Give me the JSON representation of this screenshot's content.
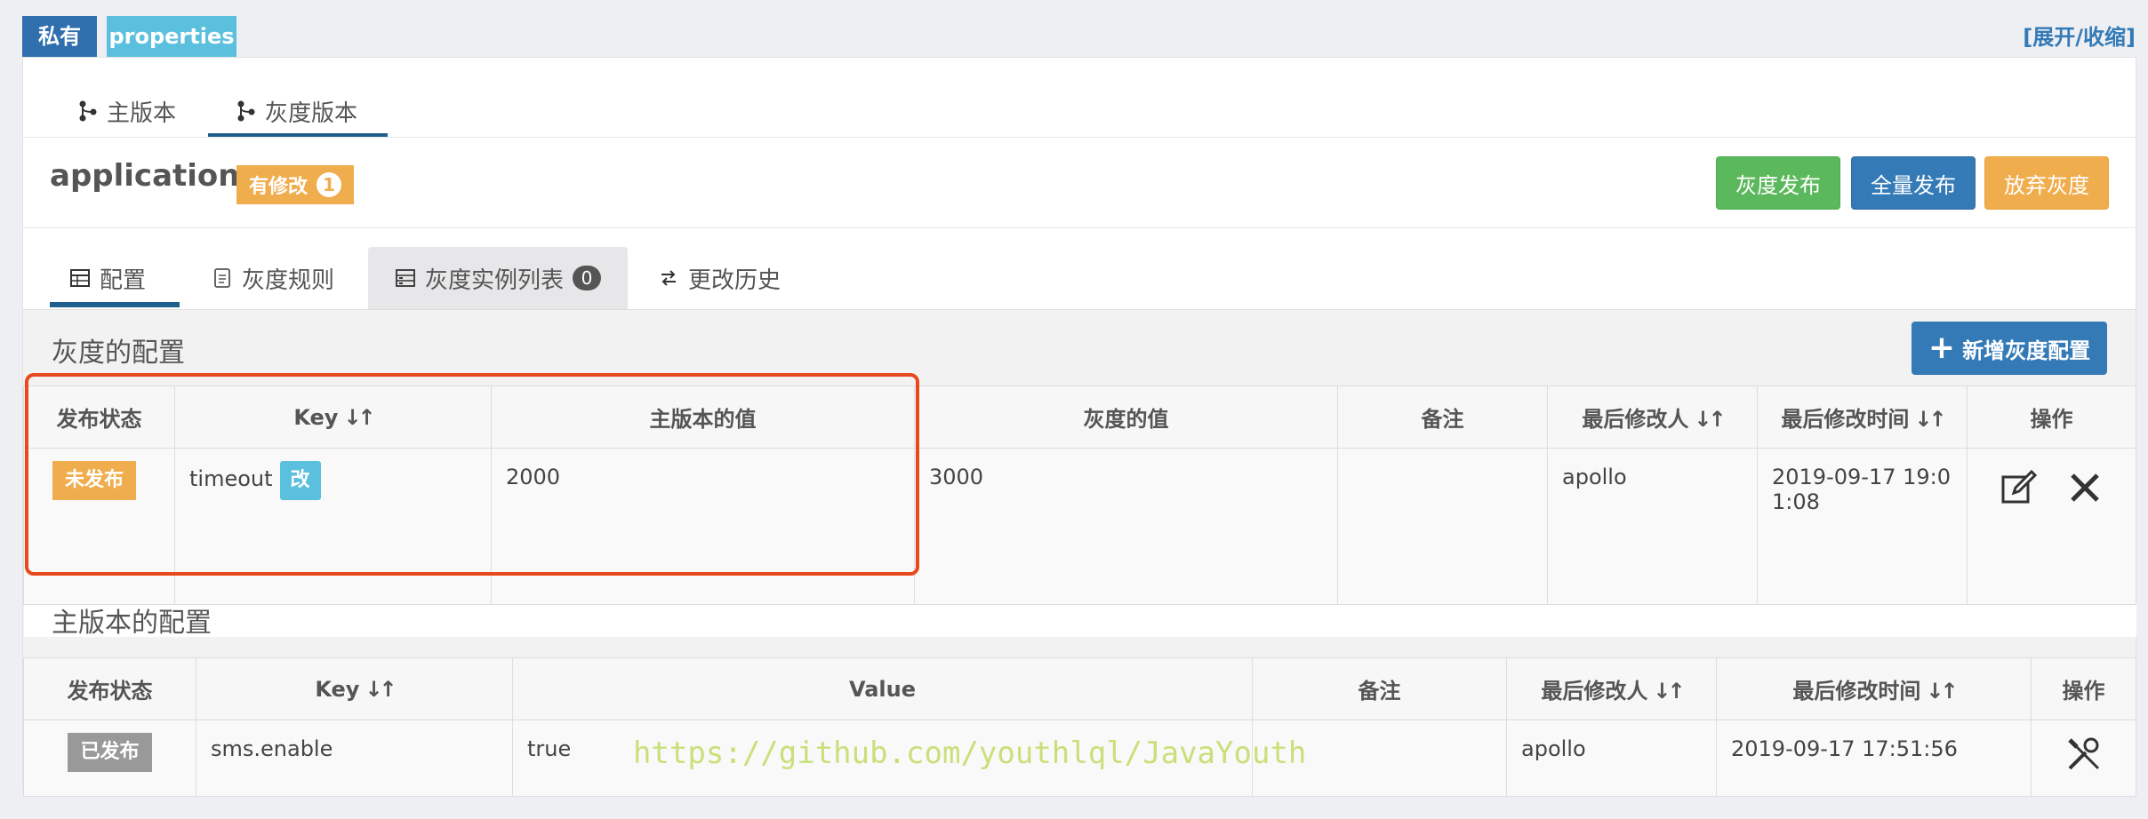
{
  "labels": {
    "private": "私有",
    "format": "properties",
    "toggle": "[展开/收缩]"
  },
  "version_tabs": {
    "main": "主版本",
    "gray": "灰度版本",
    "active": "gray"
  },
  "namespace": {
    "name": "application",
    "modified_label": "有修改",
    "modified_count": "1"
  },
  "buttons": {
    "gray_publish": "灰度发布",
    "full_publish": "全量发布",
    "abandon_gray": "放弃灰度",
    "add_gray_config": "新增灰度配置"
  },
  "sub_tabs": {
    "config": "配置",
    "rules": "灰度规则",
    "instances": "灰度实例列表",
    "instances_count": "0",
    "history": "更改历史",
    "active": "config"
  },
  "gray_section": {
    "title": "灰度的配置",
    "headers": [
      "发布状态",
      "Key",
      "主版本的值",
      "灰度的值",
      "备注",
      "最后修改人",
      "最后修改时间",
      "操作"
    ],
    "rows": [
      {
        "status": "未发布",
        "key": "timeout",
        "key_badge": "改",
        "main_value": "2000",
        "gray_value": "3000",
        "comment": "",
        "modifier": "apollo",
        "time": "2019-09-17 19:01:08"
      }
    ]
  },
  "main_section": {
    "title": "主版本的配置",
    "headers": [
      "发布状态",
      "Key",
      "Value",
      "备注",
      "最后修改人",
      "最后修改时间",
      "操作"
    ],
    "rows": [
      {
        "status": "已发布",
        "key": "sms.enable",
        "value": "true",
        "comment": "",
        "modifier": "apollo",
        "time": "2019-09-17 17:51:56"
      }
    ]
  },
  "watermark": "https://github.com/youthlql/JavaYouth",
  "colors": {
    "primary": "#337ab7",
    "success": "#5cb85c",
    "warning": "#f0ad4e",
    "info": "#5bc0de",
    "highlight": "#e8491d"
  }
}
